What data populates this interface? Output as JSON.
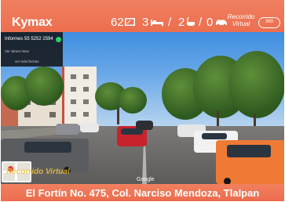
{
  "header": {
    "logo": "Kymax",
    "area": "62",
    "area_icon": "area-icon",
    "bedrooms": "3",
    "bedrooms_icon": "bed-icon",
    "separator": "/",
    "bathrooms": "2",
    "bathrooms_icon": "bathtub-icon",
    "parking": "0",
    "parking_icon": "car-icon",
    "virtual_tour_label": "Recorrido Virtual",
    "virtual_tour_badge": "360"
  },
  "contact_panel": {
    "title": "Informes 55 5252 2594",
    "whatsapp_icon": "whatsapp-icon",
    "middle_text": "Ver Street View",
    "bottom_text": "ver más fechas"
  },
  "scene": {
    "type": "street-view-photo",
    "mini_map_icon": "map-pin-icon",
    "watermark_text": "Recorrido Virtual",
    "attribution": "Google"
  },
  "footer": {
    "address": "El Fortín No. 475, Col. Narciso Mendoza, Tlalpan"
  },
  "colors": {
    "brand_orange": "#ec6f4f",
    "whatsapp_green": "#25d366",
    "watermark_yellow": "#f5c23c"
  }
}
